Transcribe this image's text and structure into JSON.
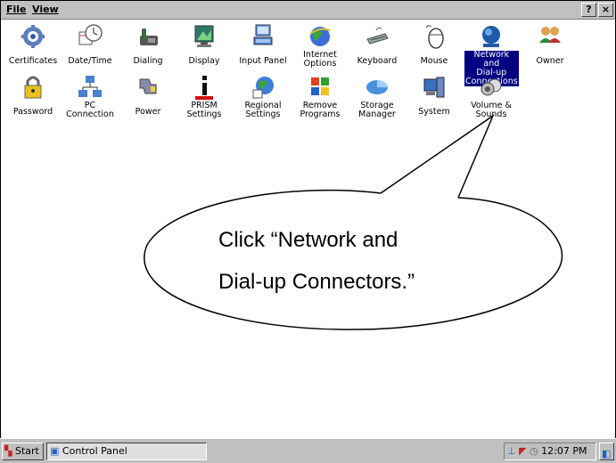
{
  "menubar": {
    "file_label": "File",
    "view_label": "View",
    "help_button": "?",
    "close_button": "×"
  },
  "row1": [
    {
      "label": "Certificates",
      "icon": "certificates-icon"
    },
    {
      "label": "Date/Time",
      "icon": "clock-icon"
    },
    {
      "label": "Dialing",
      "icon": "phone-icon"
    },
    {
      "label": "Display",
      "icon": "monitor-icon"
    },
    {
      "label": "Input Panel",
      "icon": "input-panel-icon"
    },
    {
      "label": "Internet\nOptions",
      "icon": "globe-icon"
    },
    {
      "label": "Keyboard",
      "icon": "keyboard-icon"
    },
    {
      "label": "Mouse",
      "icon": "mouse-icon"
    },
    {
      "label": "Network and\nDial-up\nConnections",
      "icon": "network-globe-icon",
      "selected": true
    },
    {
      "label": "Owner",
      "icon": "users-icon"
    }
  ],
  "row2": [
    {
      "label": "Password",
      "icon": "lock-icon"
    },
    {
      "label": "PC\nConnection",
      "icon": "pc-connection-icon"
    },
    {
      "label": "Power",
      "icon": "power-icon"
    },
    {
      "label": "PRISM\nSettings",
      "icon": "info-icon"
    },
    {
      "label": "Regional\nSettings",
      "icon": "regional-globe-icon"
    },
    {
      "label": "Remove\nPrograms",
      "icon": "remove-programs-icon"
    },
    {
      "label": "Storage\nManager",
      "icon": "storage-icon"
    },
    {
      "label": "System",
      "icon": "system-icon"
    },
    {
      "label": "Volume &\nSounds",
      "icon": "speaker-icon"
    }
  ],
  "callout": {
    "line1": "Click “Network and",
    "line2": "Dial-up Connectors.”"
  },
  "taskbar": {
    "start_label": "Start",
    "task_label": "Control Panel",
    "time": "12:07 PM"
  },
  "colors": {
    "selection": "#000080",
    "chrome": "#c0c0c0"
  }
}
